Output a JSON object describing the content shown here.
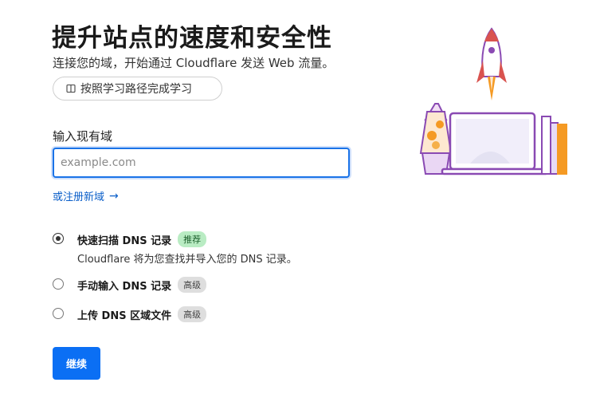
{
  "header": {
    "title": "提升站点的速度和安全性",
    "subtitle": "连接您的域，开始通过 Cloudflare 发送 Web 流量。",
    "learn_button": "按照学习路径完成学习"
  },
  "form": {
    "domain_label": "输入现有域",
    "domain_placeholder": "example.com",
    "domain_value": "",
    "register_link": "或注册新域",
    "options": [
      {
        "label": "快速扫描 DNS 记录",
        "badge": "推荐",
        "description": "Cloudflare 将为您查找并导入您的 DNS 记录。",
        "selected": true
      },
      {
        "label": "手动输入 DNS 记录",
        "badge": "高级",
        "selected": false
      },
      {
        "label": "上传 DNS 区域文件",
        "badge": "高级",
        "selected": false
      }
    ],
    "continue_button": "继续"
  },
  "colors": {
    "primary": "#0b6ff4",
    "link": "#0b5fc9",
    "badge_recommended": "#b9ecc3",
    "badge_advanced": "#dedede",
    "rocket": "#d9534f",
    "accent_purple": "#8a4ab3",
    "accent_orange": "#f59a23"
  },
  "icons": {
    "learn": "book-icon",
    "register": "arrow-right-icon",
    "illustration": "rocket-laptop-illustration"
  }
}
